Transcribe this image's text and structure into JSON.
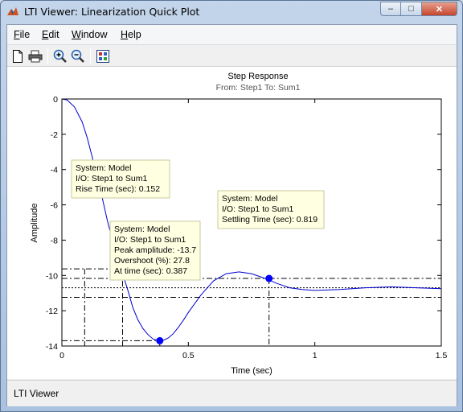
{
  "window": {
    "title": "LTI Viewer: Linearization Quick Plot",
    "buttons": {
      "minimize": "–",
      "maximize": "□",
      "close": "✕"
    }
  },
  "menu": {
    "items": [
      {
        "accel": "F",
        "rest": "ile"
      },
      {
        "accel": "E",
        "rest": "dit"
      },
      {
        "accel": "W",
        "rest": "indow"
      },
      {
        "accel": "H",
        "rest": "elp"
      }
    ]
  },
  "toolbar": {
    "icons": [
      "new-document-icon",
      "print-icon",
      "zoom-in-icon",
      "zoom-out-icon",
      "plot-configuration-icon"
    ]
  },
  "status": {
    "text": "LTI Viewer"
  },
  "chart_data": {
    "type": "line",
    "title": "Step Response",
    "subtitle": "From: Step1  To: Sum1",
    "xlabel": "Time (sec)",
    "ylabel": "Amplitude",
    "xlim": [
      0,
      1.5
    ],
    "ylim": [
      -14,
      0
    ],
    "xticks": [
      0,
      0.5,
      1,
      1.5
    ],
    "xtick_labels": [
      "0",
      "0.5",
      "1",
      "1.5"
    ],
    "yticks": [
      0,
      -2,
      -4,
      -6,
      -8,
      -10,
      -12,
      -14
    ],
    "ytick_labels": [
      "0",
      "-2",
      "-4",
      "-6",
      "-8",
      "-10",
      "-12",
      "-14"
    ],
    "series": [
      {
        "color": "#0000cc",
        "x": [
          0,
          0.02,
          0.05,
          0.08,
          0.1,
          0.12,
          0.15,
          0.18,
          0.2,
          0.22,
          0.24,
          0.26,
          0.28,
          0.3,
          0.32,
          0.34,
          0.36,
          0.387,
          0.4,
          0.42,
          0.44,
          0.46,
          0.48,
          0.5,
          0.55,
          0.6,
          0.65,
          0.7,
          0.75,
          0.8,
          0.85,
          0.9,
          0.95,
          1.0,
          1.1,
          1.2,
          1.3,
          1.4,
          1.5
        ],
        "y": [
          0,
          -0.05,
          -0.45,
          -1.3,
          -2.2,
          -3.3,
          -5.0,
          -6.9,
          -8.0,
          -9.0,
          -9.9,
          -10.8,
          -11.8,
          -12.5,
          -13.0,
          -13.35,
          -13.6,
          -13.7,
          -13.68,
          -13.55,
          -13.3,
          -12.95,
          -12.55,
          -12.1,
          -11.1,
          -10.3,
          -9.9,
          -9.8,
          -9.9,
          -10.15,
          -10.45,
          -10.7,
          -10.8,
          -10.85,
          -10.8,
          -10.7,
          -10.65,
          -10.7,
          -10.75
        ]
      }
    ],
    "reference_lines": {
      "steady_state": -10.7,
      "settling_band": [
        -10.17,
        -11.24
      ],
      "rise_levels": [
        -1.07,
        -9.63
      ],
      "rise_start_time": 0.09,
      "line_color": "#000000"
    },
    "annotations": [
      {
        "kind": "rise-time",
        "x": 0.24,
        "y": -9.63,
        "lines": [
          "System: Model",
          "I/O: Step1 to Sum1",
          "Rise Time (sec): 0.152"
        ]
      },
      {
        "kind": "peak",
        "x": 0.387,
        "y": -13.7,
        "lines": [
          "System: Model",
          "I/O: Step1 to Sum1",
          "Peak amplitude: -13.7",
          "Overshoot (%): 27.8",
          "At time (sec): 0.387"
        ]
      },
      {
        "kind": "settling-time",
        "x": 0.819,
        "y": -10.17,
        "lines": [
          "System: Model",
          "I/O: Step1 to Sum1",
          "Settling Time (sec): 0.819"
        ]
      }
    ],
    "grid": false,
    "marker_color": "#0000ff",
    "tooltip_bg": "#ffffe1"
  }
}
